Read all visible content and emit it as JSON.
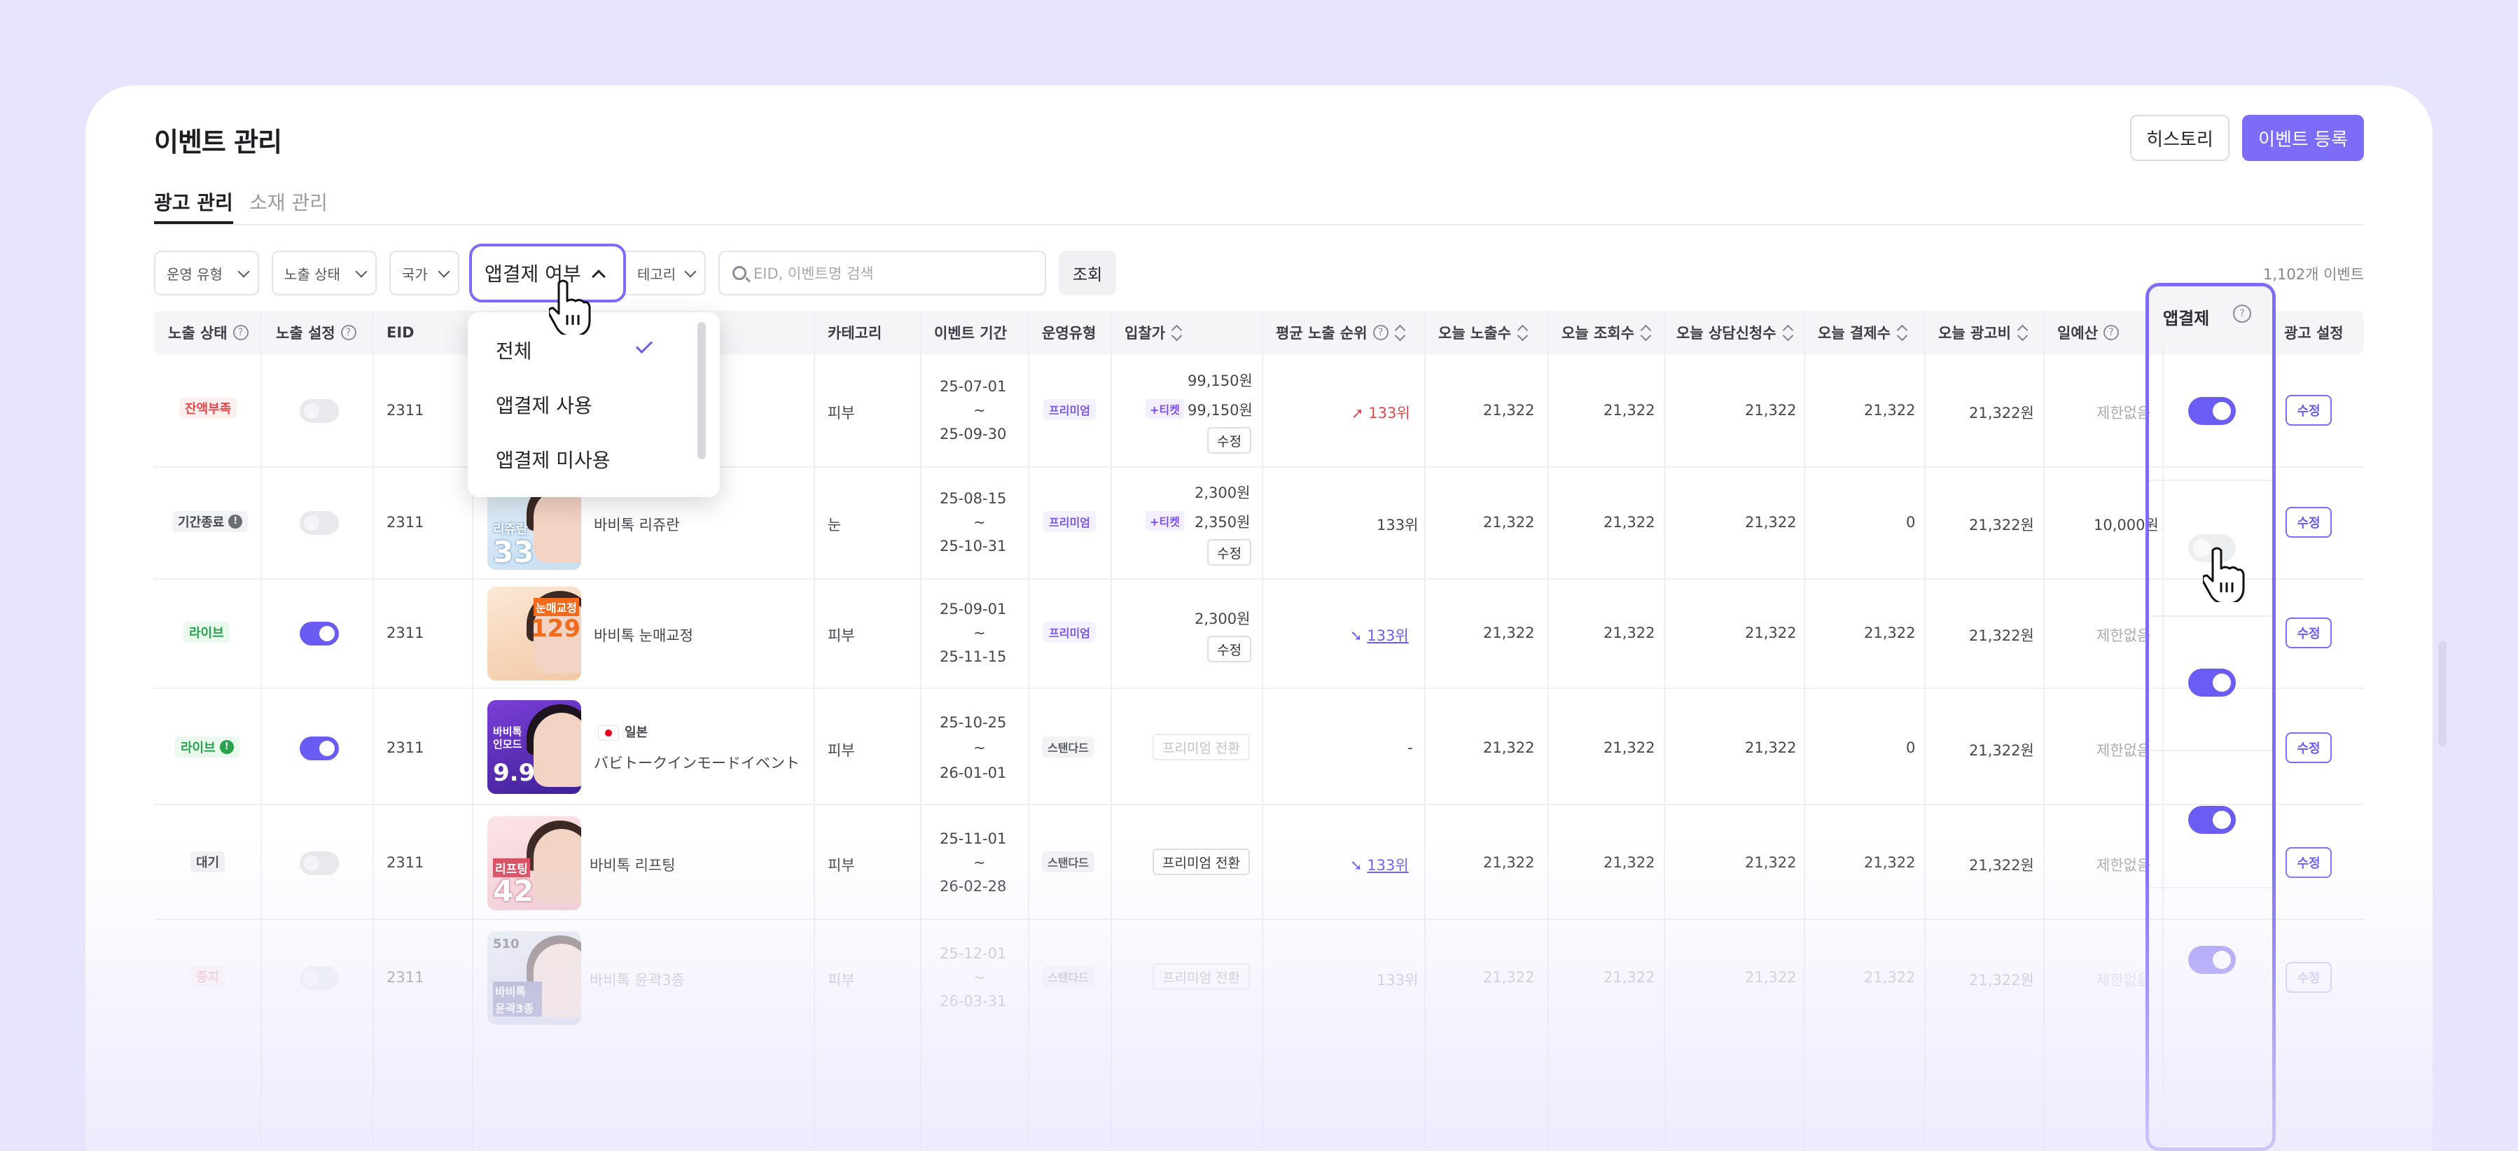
{
  "header": {
    "title": "이벤트 관리",
    "history_button": "히스토리",
    "register_button": "이벤트 등록"
  },
  "tabs": [
    {
      "label": "광고 관리",
      "active": true
    },
    {
      "label": "소재 관리",
      "active": false
    }
  ],
  "filters": {
    "operation_type": "운영 유형",
    "exposure_status": "노출 상태",
    "country": "국가",
    "app_payment": "앱결제 여부",
    "category": "테고리",
    "search_placeholder": "EID, 이벤트명 검색",
    "query_button": "조회",
    "count": "1,102개 이벤트"
  },
  "dropdown": {
    "items": [
      "전체",
      "앱결제 사용",
      "앱결제 미사용"
    ],
    "selected": "전체"
  },
  "columns": {
    "status": "노출 상태",
    "setting": "노출 설정",
    "eid": "EID",
    "category": "카테고리",
    "period": "이벤트 기간",
    "operation": "운영유형",
    "bid": "입찰가",
    "avg_rank": "평균 노출 순위",
    "today_impr": "오늘 노출수",
    "today_views": "오늘 조회수",
    "today_consult": "오늘 상담신청수",
    "today_pay": "오늘 결제수",
    "today_cost": "오늘 광고비",
    "daily_budget": "일예산",
    "app_payment": "앱결제",
    "ad_setting": "광고 설정"
  },
  "rows": [
    {
      "status": "잔액부족",
      "eid": "2311",
      "thumb_text": "",
      "thumb_number": "",
      "name": "",
      "country": "",
      "category": "피부",
      "start": "25-07-01",
      "tilde": "~",
      "end": "25-09-30",
      "operation": "프리미엄",
      "bid": "99,150원",
      "ticket_label": "+티켓",
      "ticket_bid": "99,150원",
      "bid_edit": "수정",
      "rank": "133위",
      "impr": "21,322",
      "views": "21,322",
      "consult": "21,322",
      "pay": "21,322",
      "cost": "21,322원",
      "budget": "제한없음",
      "edit": "수정"
    },
    {
      "status": "기간종료",
      "eid": "2311",
      "thumb_text": "리쥬란",
      "thumb_number": "33",
      "name": "바비톡 리쥬란",
      "country": "",
      "category": "눈",
      "start": "25-08-15",
      "tilde": "~",
      "end": "25-10-31",
      "operation": "프리미엄",
      "bid": "2,300원",
      "ticket_label": "+티켓",
      "ticket_bid": "2,350원",
      "bid_edit": "수정",
      "rank": "133위",
      "impr": "21,322",
      "views": "21,322",
      "consult": "21,322",
      "pay": "0",
      "cost": "21,322원",
      "budget": "10,000원",
      "edit": "수정"
    },
    {
      "status": "라이브",
      "eid": "2311",
      "thumb_text": "눈매교정",
      "thumb_number": "129",
      "name": "바비톡 눈매교정",
      "country": "",
      "category": "피부",
      "start": "25-09-01",
      "tilde": "~",
      "end": "25-11-15",
      "operation": "프리미엄",
      "bid": "2,300원",
      "ticket_label": "",
      "ticket_bid": "",
      "bid_edit": "수정",
      "rank": "133위",
      "impr": "21,322",
      "views": "21,322",
      "consult": "21,322",
      "pay": "21,322",
      "cost": "21,322원",
      "budget": "제한없음",
      "edit": "수정"
    },
    {
      "status": "라이브",
      "eid": "2311",
      "thumb_text": "바비톡 인모드",
      "thumb_number": "9.9",
      "name": "バビトークインモードイベント",
      "country": "일본",
      "category": "피부",
      "start": "25-10-25",
      "tilde": "~",
      "end": "26-01-01",
      "operation": "스탠다드",
      "bid": "프리미엄 전환",
      "ticket_label": "",
      "ticket_bid": "",
      "bid_edit": "",
      "rank": "-",
      "impr": "21,322",
      "views": "21,322",
      "consult": "21,322",
      "pay": "0",
      "cost": "21,322원",
      "budget": "제한없음",
      "edit": "수정"
    },
    {
      "status": "대기",
      "eid": "2311",
      "thumb_text": "리프팅",
      "thumb_number": "42",
      "name": "바비톡 리프팅",
      "country": "",
      "category": "피부",
      "start": "25-11-01",
      "tilde": "~",
      "end": "26-02-28",
      "operation": "스탠다드",
      "bid": "프리미엄 전환",
      "ticket_label": "",
      "ticket_bid": "",
      "bid_edit": "",
      "rank": "133위",
      "impr": "21,322",
      "views": "21,322",
      "consult": "21,322",
      "pay": "21,322",
      "cost": "21,322원",
      "budget": "제한없음",
      "edit": "수정"
    },
    {
      "status": "중지",
      "eid": "2311",
      "thumb_text": "바비톡 윤곽3종",
      "thumb_number": "510",
      "name": "바비톡 윤곽3종",
      "country": "",
      "category": "피부",
      "start": "25-12-01",
      "tilde": "~",
      "end": "26-03-31",
      "operation": "스탠다드",
      "bid": "프리미엄 전환",
      "ticket_label": "",
      "ticket_bid": "",
      "bid_edit": "",
      "rank": "133위",
      "impr": "21,322",
      "views": "21,322",
      "consult": "21,322",
      "pay": "21,322",
      "cost": "21,322원",
      "budget": "제한없음",
      "edit": "수정"
    }
  ],
  "colors": {
    "accent": "#7c6cf8",
    "toggle_on": "#6a5cf3",
    "rank_up": "#e2474b",
    "background": "#e7e4fd"
  },
  "icons": {
    "help": "help-circle-icon",
    "sort": "sort-icon",
    "search": "search-icon",
    "check": "check-icon",
    "cursor": "hand-pointer-icon"
  }
}
